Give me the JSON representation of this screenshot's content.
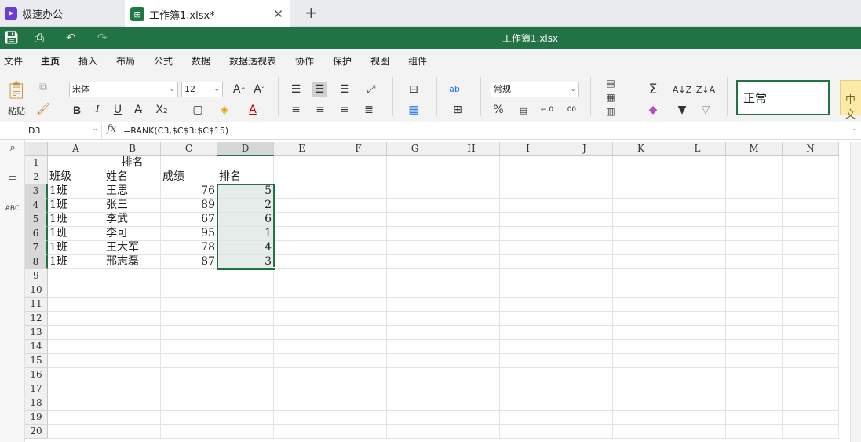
{
  "tabs": {
    "app_tab": {
      "label": "极速办公",
      "icon": "rocket-icon"
    },
    "doc_tab": {
      "label": "工作簿1.xlsx*",
      "icon": "spreadsheet-icon"
    },
    "close": "✕",
    "add": "+"
  },
  "titlebar": {
    "title": "工作簿1.xlsx",
    "color": "#217346"
  },
  "menu": [
    "文件",
    "主页",
    "插入",
    "布局",
    "公式",
    "数据",
    "数据透视表",
    "协作",
    "保护",
    "视图",
    "组件"
  ],
  "menu_active": "主页",
  "ribbon": {
    "paste_label": "粘贴",
    "font_name": "宋体",
    "font_size": "12",
    "bold": "B",
    "italic": "I",
    "underline": "U",
    "number_format": "常规",
    "percent": "%",
    "cell_style": "正常",
    "cell_style_next": "中文"
  },
  "formula_bar": {
    "name_box": "D3",
    "fx": "fx",
    "formula": "=RANK(C3,$C$3:$C$15)"
  },
  "columns": [
    "A",
    "B",
    "C",
    "D",
    "E",
    "F",
    "G",
    "H",
    "I",
    "J",
    "K",
    "L",
    "M",
    "N"
  ],
  "rows": [
    "1",
    "2",
    "3",
    "4",
    "5",
    "6",
    "7",
    "8",
    "9",
    "10",
    "11",
    "12",
    "13",
    "14",
    "15",
    "16",
    "17",
    "18",
    "19",
    "20"
  ],
  "sheet": {
    "title": "排名",
    "headers": [
      "班级",
      "姓名",
      "成绩",
      "排名"
    ],
    "data": [
      [
        "1班",
        "王思",
        "76",
        "5"
      ],
      [
        "1班",
        "张三",
        "89",
        "2"
      ],
      [
        "1班",
        "李武",
        "67",
        "6"
      ],
      [
        "1班",
        "李可",
        "95",
        "1"
      ],
      [
        "1班",
        "王大军",
        "78",
        "4"
      ],
      [
        "1班",
        "邢志磊",
        "87",
        "3"
      ]
    ]
  },
  "selected_column": "D",
  "selected_rows": [
    "3",
    "4",
    "5",
    "6",
    "7",
    "8"
  ]
}
